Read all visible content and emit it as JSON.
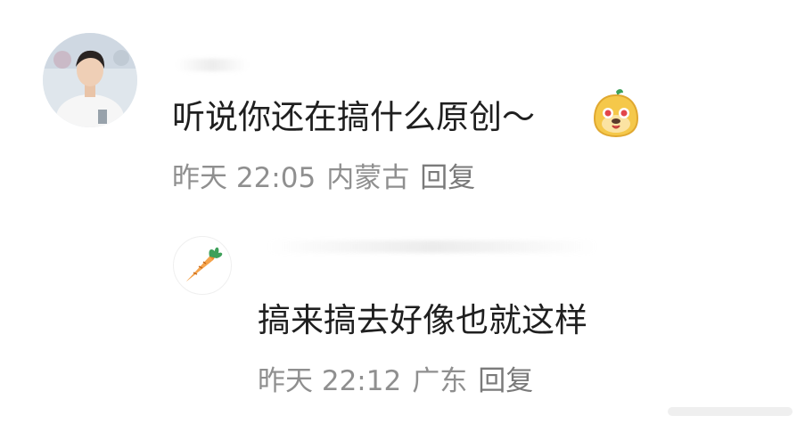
{
  "comment": {
    "text": "听说你还在搞什么原创～",
    "emoji": "smile-face-emoji",
    "time": "昨天 22:05",
    "location": "内蒙古",
    "reply_label": "回复"
  },
  "reply": {
    "text": "搞来搞去好像也就这样",
    "time": "昨天 22:12",
    "location": "广东",
    "reply_label": "回复"
  },
  "colors": {
    "text": "#1f1f1f",
    "meta": "#8f8f8f",
    "emoji_body": "#f5c84a",
    "carrot": "#f08a2c"
  }
}
